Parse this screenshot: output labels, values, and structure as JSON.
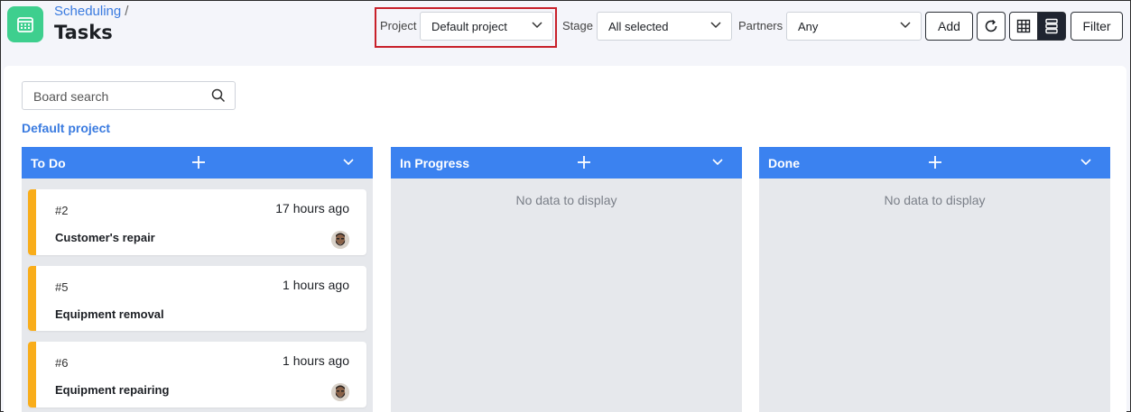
{
  "header": {
    "breadcrumb_parent": "Scheduling",
    "breadcrumb_sep": "/",
    "title": "Tasks",
    "app_icon": "calendar-icon"
  },
  "filters": {
    "project_label": "Project",
    "project_value": "Default project",
    "stage_label": "Stage",
    "stage_value": "All selected",
    "partners_label": "Partners",
    "partners_value": "Any"
  },
  "toolbar": {
    "add_label": "Add",
    "refresh_icon": "refresh-icon",
    "grid_view_icon": "grid-view-icon",
    "list_view_icon": "list-view-icon",
    "filter_label": "Filter"
  },
  "board": {
    "search_placeholder": "Board search",
    "project_name": "Default project",
    "columns": [
      {
        "title": "To Do",
        "empty_text": ""
      },
      {
        "title": "In Progress",
        "empty_text": "No data to display"
      },
      {
        "title": "Done",
        "empty_text": "No data to display"
      }
    ],
    "cards": [
      {
        "number": "#2",
        "time": "17 hours ago",
        "name": "Customer's repair",
        "has_avatar": true
      },
      {
        "number": "#5",
        "time": "1 hours ago",
        "name": "Equipment removal",
        "has_avatar": false
      },
      {
        "number": "#6",
        "time": "1 hours ago",
        "name": "Equipment repairing",
        "has_avatar": true
      }
    ]
  },
  "colors": {
    "accent_blue": "#3b82f0",
    "card_stripe": "#f9ad1a",
    "app_icon_bg": "#3ecf8e",
    "highlight_red": "#c8202a"
  }
}
